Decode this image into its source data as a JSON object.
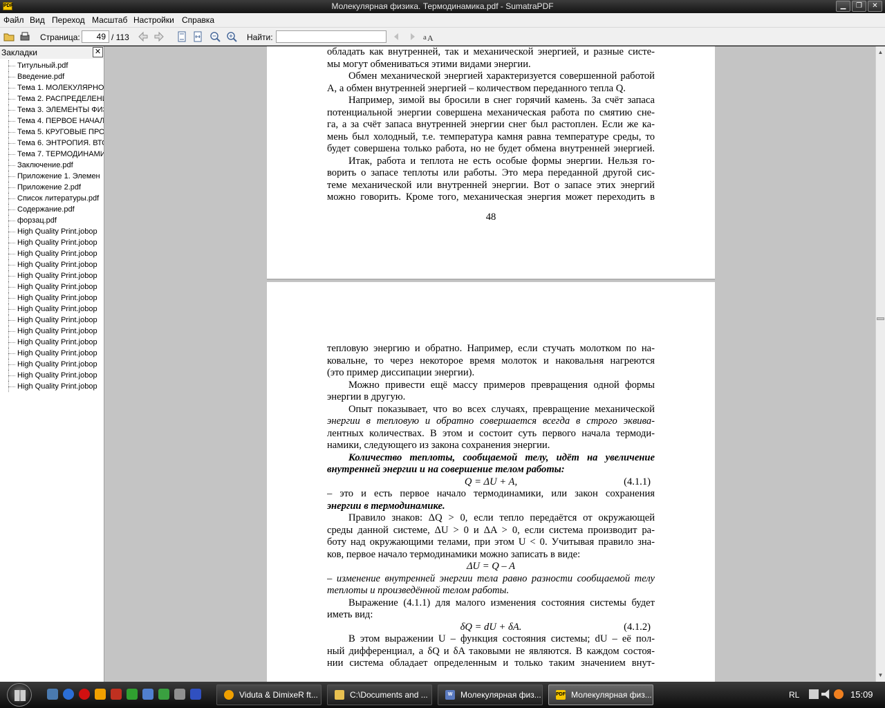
{
  "window": {
    "title": "Молекулярная физика. Термодинамика.pdf - SumatraPDF",
    "app_icon_text": "PDF"
  },
  "menu": [
    "Файл",
    "Вид",
    "Переход",
    "Масштаб",
    "Настройки",
    "Справка"
  ],
  "toolbar": {
    "page_label": "Страница:",
    "page_value": "49",
    "page_total": "/ 113",
    "find_label": "Найти:",
    "find_value": ""
  },
  "sidebar": {
    "title": "Закладки",
    "items": [
      "Титульный.pdf",
      "Введение.pdf",
      "Тема 1. МОЛЕКУЛЯРНО-",
      "Тема 2. РАСПРЕДЕЛЕНИ",
      "Тема 3. ЭЛЕМЕНТЫ ФИЗИ",
      "Тема 4. ПЕРВОЕ НАЧАЛО",
      "Тема 5.  КРУГОВЫЕ ПРО",
      "Тема 6. ЭНТРОПИЯ. ВТО",
      "Тема 7. ТЕРМОДИНАМИ",
      "Заключение.pdf",
      "Приложение 1. Элемен",
      "Приложение 2.pdf",
      "Список литературы.pdf",
      "Содержание.pdf",
      "форзац.pdf",
      "High Quality Print.jobop",
      "High Quality Print.jobop",
      "High Quality Print.jobop",
      "High Quality Print.jobop",
      "High Quality Print.jobop",
      "High Quality Print.jobop",
      "High Quality Print.jobop",
      "High Quality Print.jobop",
      "High Quality Print.jobop",
      "High Quality Print.jobop",
      "High Quality Print.jobop",
      "High Quality Print.jobop",
      "High Quality Print.jobop",
      "High Quality Print.jobop",
      "High Quality Print.jobop"
    ]
  },
  "document": {
    "page1": {
      "lines": [
        "обладать как внутренней, так и механической энергией, и разные систе-",
        "мы могут обмениваться этими видами энергии.",
        "Обмен механической энергией характеризуется совершенной работой",
        "A, а обмен внутренней энергией – количеством переданного тепла Q.",
        "Например, зимой вы бросили в снег горячий камень. За счёт запаса",
        "потенциальной энергии совершена механическая работа по смятию сне-",
        "га, а за счёт запаса внутренней энергии снег был растоплен. Если же ка-",
        "мень был холодный, т.е. температура камня равна температуре среды, то",
        "будет совершена только работа, но не будет обмена внутренней энергией.",
        "Итак, работа и теплота не есть особые формы энергии. Нельзя го-",
        "ворить о запасе теплоты или работы. Это мера переданной другой сис-",
        "теме механической или внутренней энергии. Вот о запасе этих энергий",
        "можно говорить. Кроме того, механическая энергия может переходить в"
      ],
      "page_number": "48"
    },
    "page2": {
      "lines": [
        "тепловую энергию и обратно. Например, если стучать молотком по на-",
        "ковальне, то через некоторое время молоток и наковальня нагреются",
        "(это пример диссипации энергии).",
        "Можно привести ещё массу примеров превращения одной формы",
        "энергии в другую.",
        "Опыт показывает, что во всех случаях, превращение механической",
        "энергии в тепловую и обратно совершается всегда в строго эквива-",
        "лентных количествах. В этом и состоит суть первого начала термоди-",
        "намики, следующего из закона сохранения энергии.",
        "Количество теплоты, сообщаемой телу, идёт на увеличение",
        "внутренней энергии и на совершение телом работы:"
      ],
      "eq1": "Q = ΔU + A,",
      "eq1_num": "(4.1.1)",
      "lines2": [
        "– это и есть первое начало термодинамики, или закон сохранения",
        "энергии в термодинамике.",
        "Правило знаков: ΔQ > 0, если тепло передаётся от окружающей",
        "среды данной системе, ΔU > 0 и ΔA > 0, если система производит ра-",
        "боту над окружающими телами, при этом U < 0. Учитывая правило зна-",
        "ков, первое начало термодинамики можно записать в виде:"
      ],
      "eq2": "ΔU = Q – A",
      "lines3": [
        "– изменение внутренней энергии тела равно разности сообщаемой телу",
        "теплоты и произведённой телом работы.",
        "Выражение (4.1.1) для малого изменения состояния системы будет",
        "иметь вид:"
      ],
      "eq3": "δQ = dU + δA.",
      "eq3_num": "(4.1.2)",
      "lines4": [
        "В этом выражении U – функция состояния системы; dU – её пол-",
        "ный дифференциал, а δQ и δA таковыми не являются. В каждом состоя-",
        "нии система обладает определенным и только таким значением внут-"
      ]
    }
  },
  "taskbar": {
    "tasks": [
      {
        "label": "Viduta & DimixeR ft...",
        "icon": "aimp-icon"
      },
      {
        "label": "C:\\Documents and ...",
        "icon": "folder-icon"
      },
      {
        "label": "Молекулярная физ...",
        "icon": "word-icon"
      },
      {
        "label": "Молекулярная физ...",
        "icon": "sumatra-icon"
      }
    ],
    "language": "RL",
    "clock": "15:09"
  },
  "colors": {
    "viewer_bg": "#c4c4c4",
    "titlebar": "#1e1e1e",
    "taskbar": "#1a1a1a",
    "app_icon": "#f6c600"
  }
}
